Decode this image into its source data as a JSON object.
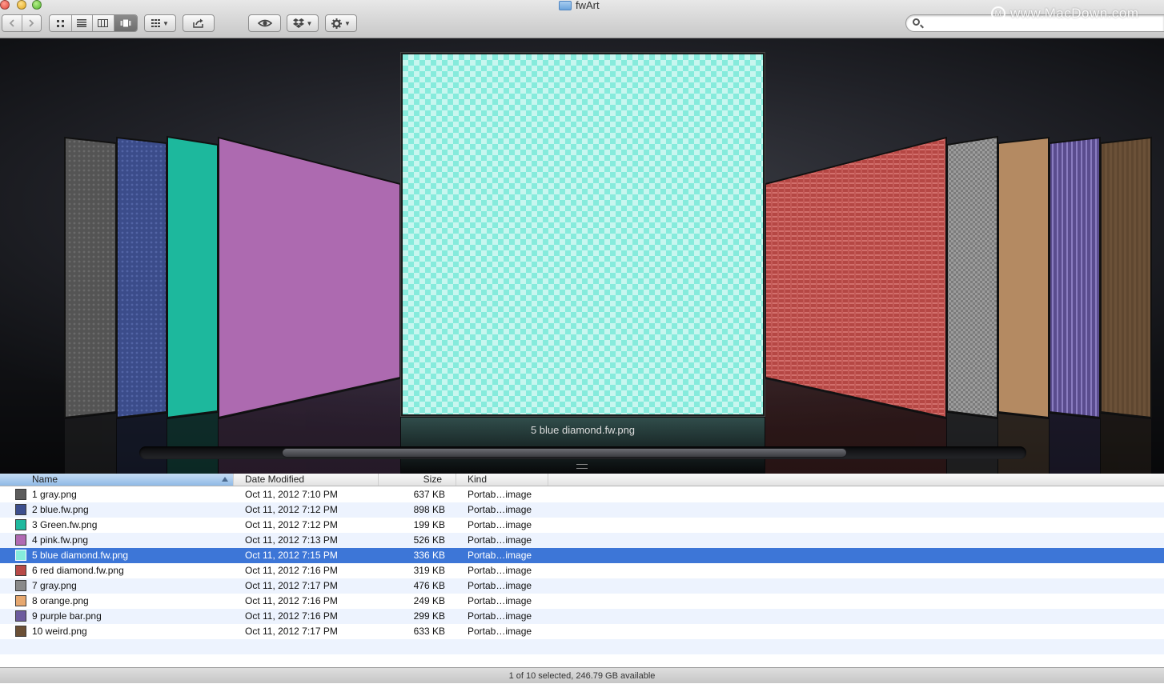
{
  "window": {
    "title": "fwArt"
  },
  "watermark": "www.MacDown.com",
  "toolbar": {
    "back_icon": "chevron-left-icon",
    "forward_icon": "chevron-right-icon",
    "view_modes": [
      "icon-view-icon",
      "list-view-icon",
      "column-view-icon",
      "coverflow-view-icon"
    ],
    "active_view": "coverflow",
    "arrange_icon": "arrange-grid-icon",
    "share_icon": "share-icon",
    "quicklook_icon": "eye-icon",
    "dropbox_icon": "dropbox-icon",
    "action_icon": "gear-icon",
    "search": {
      "placeholder": "",
      "value": ""
    }
  },
  "coverflow": {
    "selected_label": "5 blue diamond.fw.png"
  },
  "columns": {
    "name": "Name",
    "date": "Date Modified",
    "size": "Size",
    "kind": "Kind"
  },
  "files": [
    {
      "name": "1 gray.png",
      "date": "Oct 11, 2012 7:10 PM",
      "size": "637 KB",
      "kind": "Portab…image",
      "color": "#5c5c5c"
    },
    {
      "name": "2 blue.fw.png",
      "date": "Oct 11, 2012 7:12 PM",
      "size": "898 KB",
      "kind": "Portab…image",
      "color": "#3d4f8e"
    },
    {
      "name": "3 Green.fw.png",
      "date": "Oct 11, 2012 7:12 PM",
      "size": "199 KB",
      "kind": "Portab…image",
      "color": "#1fb99e"
    },
    {
      "name": "4 pink.fw.png",
      "date": "Oct 11, 2012 7:13 PM",
      "size": "526 KB",
      "kind": "Portab…image",
      "color": "#b06ab3"
    },
    {
      "name": "5 blue diamond.fw.png",
      "date": "Oct 11, 2012 7:15 PM",
      "size": "336 KB",
      "kind": "Portab…image",
      "color": "#86ebdc"
    },
    {
      "name": "6 red diamond.fw.png",
      "date": "Oct 11, 2012 7:16 PM",
      "size": "319 KB",
      "kind": "Portab…image",
      "color": "#b84a48"
    },
    {
      "name": "7 gray.png",
      "date": "Oct 11, 2012 7:17 PM",
      "size": "476 KB",
      "kind": "Portab…image",
      "color": "#8a8a8a"
    },
    {
      "name": "8 orange.png",
      "date": "Oct 11, 2012 7:16 PM",
      "size": "249 KB",
      "kind": "Portab…image",
      "color": "#e6a870"
    },
    {
      "name": "9 purple bar.png",
      "date": "Oct 11, 2012 7:16 PM",
      "size": "299 KB",
      "kind": "Portab…image",
      "color": "#6c5b9e"
    },
    {
      "name": "10 weird.png",
      "date": "Oct 11, 2012 7:17 PM",
      "size": "633 KB",
      "kind": "Portab…image",
      "color": "#6b5036"
    }
  ],
  "selected_index": 4,
  "status": "1 of 10 selected, 246.79 GB available"
}
